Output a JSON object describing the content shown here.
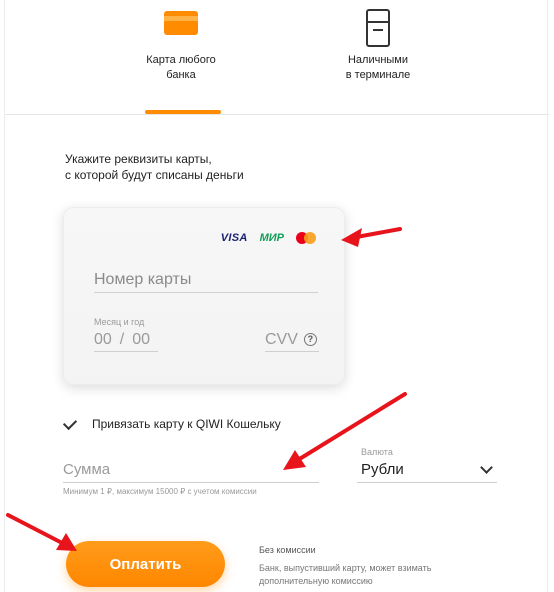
{
  "tabs": [
    {
      "label": "Карта любого\nбанка",
      "icon": "credit-card-icon",
      "active": true
    },
    {
      "label": "Наличными\nв терминале",
      "icon": "terminal-icon",
      "active": false
    }
  ],
  "colors": {
    "accent": "#ff8c00",
    "arrow": "#e8141c"
  },
  "form": {
    "instruction": "Укажите реквизиты карты,\nс которой будут списаны деньги",
    "card": {
      "brands": [
        "VISA",
        "МИР",
        "mastercard"
      ],
      "number_placeholder": "Номер карты",
      "expiry_label": "Месяц и год",
      "expiry_month": "00",
      "expiry_sep": "/",
      "expiry_year": "00",
      "cvv_label": "CVV",
      "help_symbol": "?"
    },
    "bind_card": {
      "label": "Привязать карту к QIWI Кошельку",
      "checked": true
    },
    "amount": {
      "placeholder": "Сумма",
      "hint": "Минимум 1 ₽, максимум 15000 ₽ с учетом комиссии"
    },
    "currency": {
      "label": "Валюта",
      "value": "Рубли"
    },
    "pay_button": "Оплатить",
    "fee": {
      "title": "Без комиссии",
      "note": "Банк, выпустивший карту, может взимать дополнительную комиссию"
    }
  }
}
